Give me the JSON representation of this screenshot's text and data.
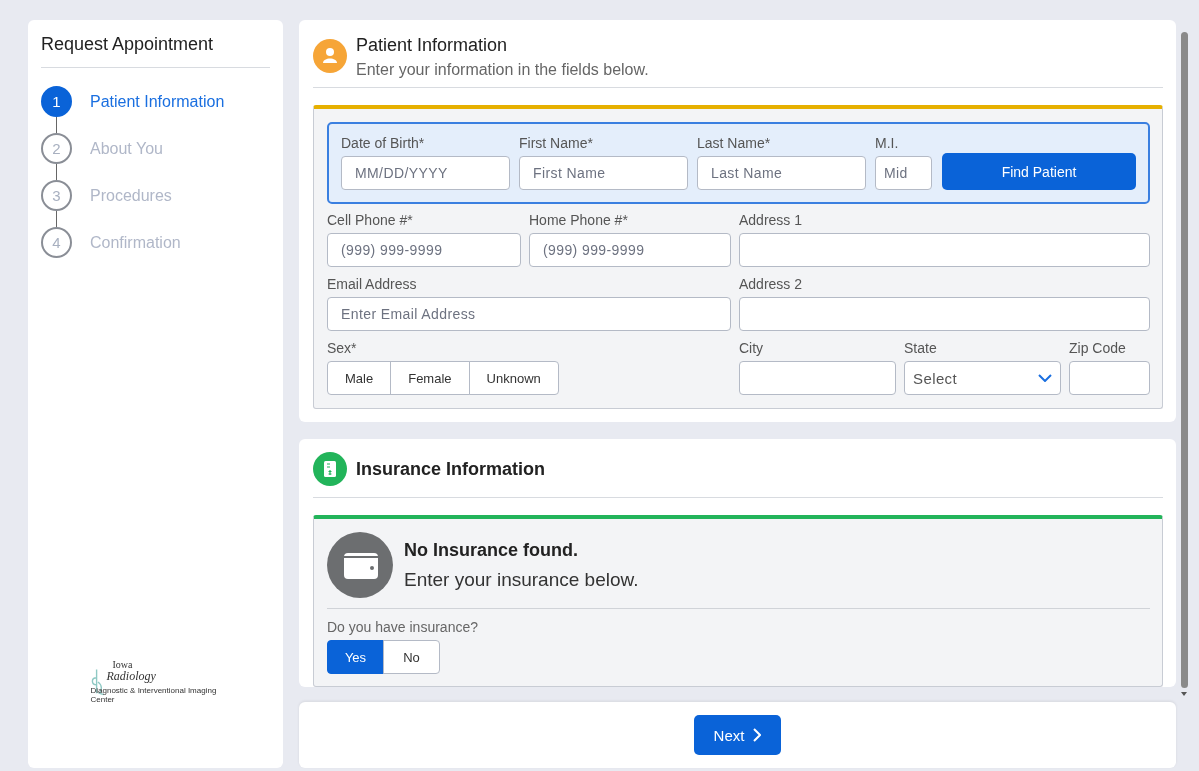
{
  "sidebar": {
    "title": "Request Appointment",
    "steps": [
      {
        "number": "1",
        "label": "Patient Information",
        "selected": true
      },
      {
        "number": "2",
        "label": "About You",
        "selected": false
      },
      {
        "number": "3",
        "label": "Procedures",
        "selected": false
      },
      {
        "number": "4",
        "label": "Confirmation",
        "selected": false
      }
    ],
    "logo": {
      "line_1": "Iowa",
      "line_2": "Radiology",
      "tagline": "Diagnostic & Interventional Imaging Center"
    }
  },
  "patient_section": {
    "title": "Patient Information",
    "subtitle": "Enter your information in the fields below.",
    "lookup_fields": [
      {
        "label": "Date of Birth*",
        "placeholder": "MM/DD/YYYY"
      },
      {
        "label": "First Name*",
        "placeholder": "First Name"
      },
      {
        "label": "Last Name*",
        "placeholder": "Last Name"
      },
      {
        "label": "M.I.",
        "placeholder": "Mid"
      }
    ],
    "find_button": "Find Patient",
    "phone_fields": [
      {
        "label": "Cell Phone #*",
        "placeholder": "(999) 999-9999"
      },
      {
        "label": "Home Phone #*",
        "placeholder": "(999) 999-9999"
      }
    ],
    "email_field": {
      "label": "Email Address",
      "placeholder": "Enter Email Address"
    },
    "sex": {
      "label": "Sex*",
      "options": [
        {
          "label": "Male",
          "selected": false
        },
        {
          "label": "Female",
          "selected": false
        },
        {
          "label": "Unknown",
          "selected": false
        }
      ]
    },
    "address_fields": [
      {
        "label": "Address 1"
      },
      {
        "label": "Address 2"
      }
    ],
    "city_field": {
      "label": "City"
    },
    "state_field": {
      "label": "State",
      "value": "Select"
    },
    "zip_field": {
      "label": "Zip Code"
    }
  },
  "insurance_section": {
    "title": "Insurance Information",
    "notice_title": "No Insurance found.",
    "notice_text": "Enter your insurance below.",
    "question": "Do you have insurance?",
    "options": [
      {
        "label": "Yes",
        "selected": true
      },
      {
        "label": "No",
        "selected": false
      }
    ]
  },
  "footer": {
    "next_button": "Next"
  }
}
